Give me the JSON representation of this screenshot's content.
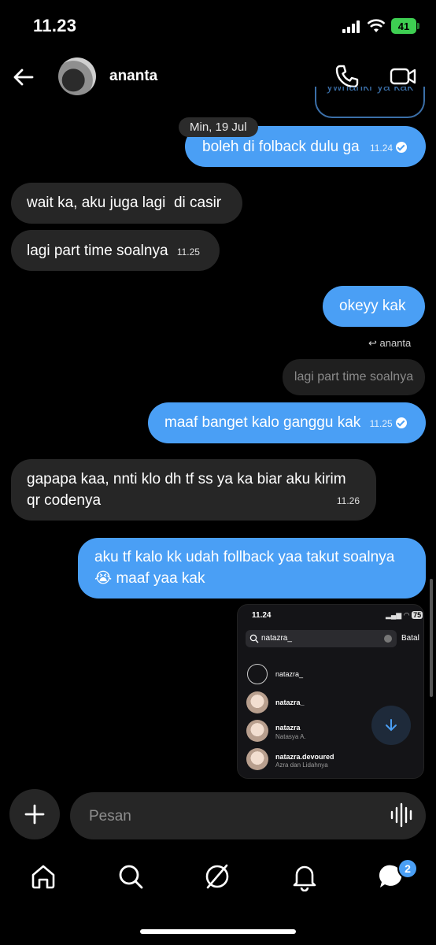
{
  "status_bar": {
    "time": "11.23",
    "battery": "41"
  },
  "header": {
    "contact_name": "ananta"
  },
  "partial_message": "ywhahkr ya kak",
  "date_chip": "Min, 19 Jul",
  "messages": [
    {
      "direction": "out",
      "text": "boleh di folback dulu ga",
      "time": "11.24"
    },
    {
      "direction": "in",
      "text": "wait ka, aku juga lagi  di casir",
      "time": ""
    },
    {
      "direction": "in",
      "text": "lagi part time soalnya",
      "time": "11.25"
    },
    {
      "direction": "out",
      "text": "okeyy kak",
      "time": ""
    },
    {
      "direction": "out",
      "text": "maaf banget kalo ganggu kak",
      "time": "11.25"
    },
    {
      "direction": "in",
      "text": "gapapa kaa, nnti klo dh tf ss ya ka biar aku kirim qr codenya",
      "time": "11.26"
    },
    {
      "direction": "out",
      "text": "aku tf kalo kk udah follback yaa takut soalnya 😭 maaf yaa kak",
      "time": ""
    }
  ],
  "reply": {
    "to": "ananta",
    "quoted": "lagi part time soalnya"
  },
  "screenshot_preview": {
    "time": "11.24",
    "status": "75",
    "search_value": "natazra_",
    "cancel_label": "Batal",
    "results": [
      {
        "name": "natazra_",
        "sub": ""
      },
      {
        "name": "natazra_",
        "sub": ""
      },
      {
        "name": "natazra",
        "sub": "Natasya A."
      },
      {
        "name": "natazra.devoured",
        "sub": "Azra dan Lidahnya"
      }
    ]
  },
  "composer": {
    "placeholder": "Pesan"
  },
  "nav": {
    "messages_badge": "2"
  },
  "colors": {
    "outgoing": "#4a9ff5",
    "incoming": "#262626",
    "background": "#000000"
  }
}
